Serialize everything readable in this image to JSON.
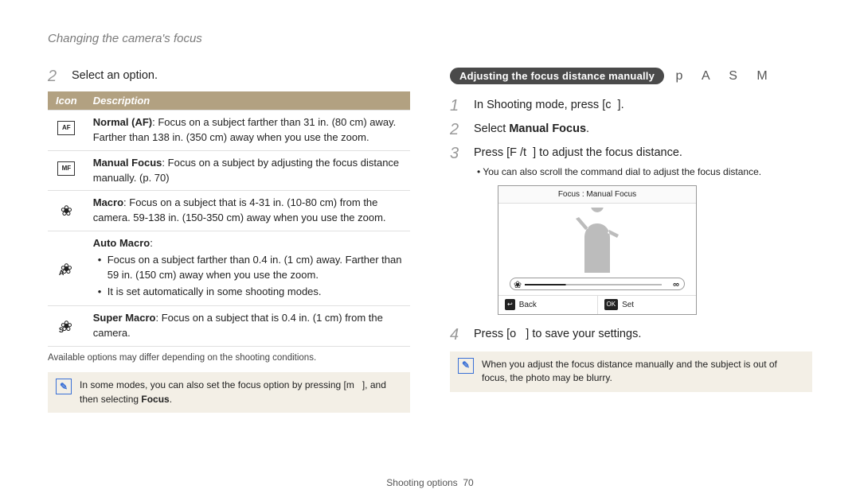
{
  "header": {
    "title": "Changing the camera's focus"
  },
  "left": {
    "step2_num": "2",
    "step2_text": "Select an option.",
    "table": {
      "head_icon": "Icon",
      "head_desc": "Description",
      "rows": [
        {
          "icon_text": "AF",
          "desc_html": "<strong>Normal (AF)</strong>: Focus on a subject farther than 31 in. (80 cm) away. Farther than 138 in. (350 cm) away when you use the zoom."
        },
        {
          "icon_text": "MF",
          "desc_html": "<strong>Manual Focus</strong>: Focus on a subject by adjusting the focus distance manually. (p. 70)"
        },
        {
          "icon_type": "flower",
          "desc_html": "<strong>Macro</strong>: Focus on a subject that is 4-31 in. (10-80 cm) from the camera. 59-138 in. (150-350 cm) away when you use the zoom."
        },
        {
          "icon_type": "flower_a",
          "desc_html": "<strong>Auto Macro</strong>:<ul class='inner-list'><li>Focus on a subject farther than 0.4 in. (1 cm) away. Farther than 59 in. (150 cm) away when you use the zoom.</li><li>It is set automatically in some shooting modes.</li></ul>"
        },
        {
          "icon_type": "flower_s",
          "desc_html": "<strong>Super Macro</strong>: Focus on a subject that is 0.4 in. (1 cm) from the camera."
        }
      ]
    },
    "footnote": "Available options may differ depending on the shooting conditions.",
    "note_html": "In some modes, you can also set the focus option by pressing [m&nbsp;&nbsp;&nbsp;], and then selecting <strong>Focus</strong>."
  },
  "right": {
    "section_title": "Adjusting the focus distance manually",
    "mode_letters": "p A S M",
    "step1_num": "1",
    "step1_html": "In Shooting mode, press [c&nbsp;&nbsp;].",
    "step2_num": "2",
    "step2_html": "Select <strong>Manual Focus</strong>.",
    "step3_num": "3",
    "step3_html": "Press [F&nbsp;/t&nbsp;&nbsp;] to adjust the focus distance.",
    "step3_sub": "You can also scroll the command dial to adjust the focus distance.",
    "lcd_title": "Focus : Manual Focus",
    "lcd_back": "Back",
    "lcd_set": "Set",
    "step4_num": "4",
    "step4_html": "Press [o&nbsp;&nbsp;&nbsp;] to save your settings.",
    "note2": "When you adjust the focus distance manually and the subject is out of focus, the photo may be blurry."
  },
  "footer": {
    "section": "Shooting options",
    "page": "70"
  }
}
